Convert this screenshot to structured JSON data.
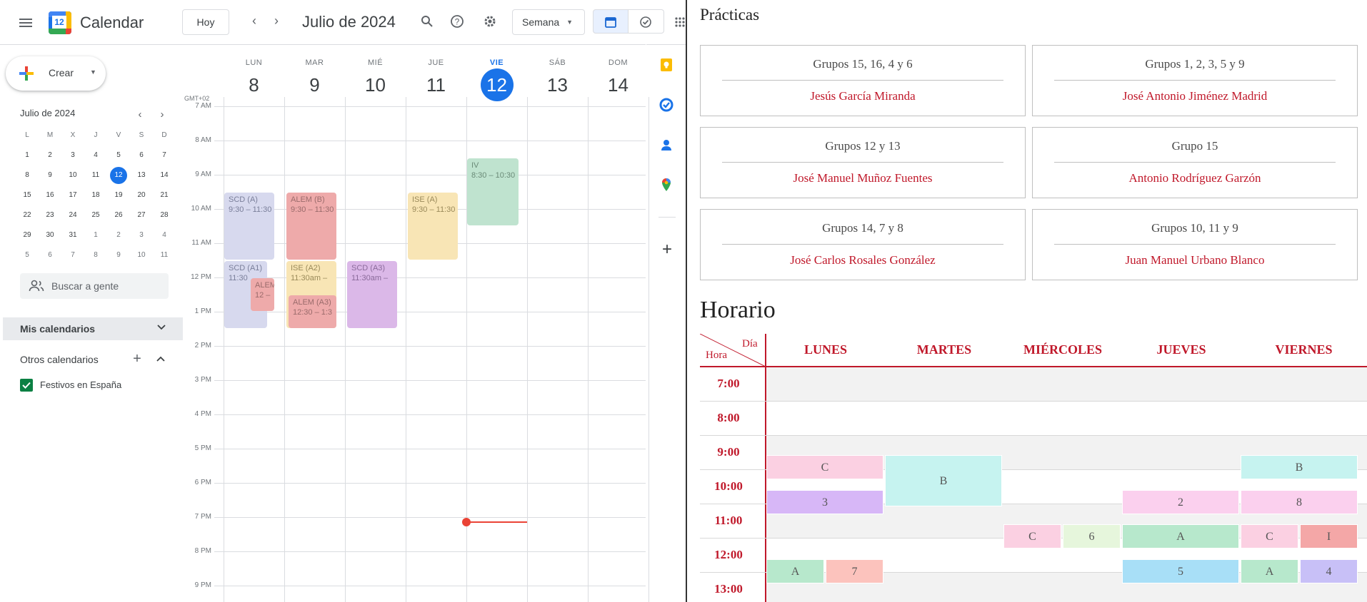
{
  "app": {
    "logo_day": "12",
    "name": "Calendar",
    "today_button": "Hoy",
    "month_title": "Julio de 2024",
    "view_select": "Semana"
  },
  "sidebar": {
    "create_label": "Crear",
    "mini_title": "Julio de 2024",
    "weekday_initials": [
      "L",
      "M",
      "X",
      "J",
      "V",
      "S",
      "D"
    ],
    "weeks": [
      [
        "1",
        "2",
        "3",
        "4",
        "5",
        "6",
        "7"
      ],
      [
        "8",
        "9",
        "10",
        "11",
        "12",
        "13",
        "14"
      ],
      [
        "15",
        "16",
        "17",
        "18",
        "19",
        "20",
        "21"
      ],
      [
        "22",
        "23",
        "24",
        "25",
        "26",
        "27",
        "28"
      ],
      [
        "29",
        "30",
        "31",
        "1",
        "2",
        "3",
        "4"
      ],
      [
        "5",
        "6",
        "7",
        "8",
        "9",
        "10",
        "11"
      ]
    ],
    "search_people": "Buscar a gente",
    "my_calendars": "Mis calendarios",
    "other_calendars": "Otros calendarios",
    "holidays_calendar": "Festivos en España",
    "holidays_color": "#0b8043"
  },
  "week": {
    "timezone": "GMT+02",
    "days": [
      {
        "label": "LUN",
        "num": "8"
      },
      {
        "label": "MAR",
        "num": "9"
      },
      {
        "label": "MIÉ",
        "num": "10"
      },
      {
        "label": "JUE",
        "num": "11"
      },
      {
        "label": "VIE",
        "num": "12"
      },
      {
        "label": "SÁB",
        "num": "13"
      },
      {
        "label": "DOM",
        "num": "14"
      }
    ],
    "today_index": 4,
    "hours": [
      "7 AM",
      "8 AM",
      "9 AM",
      "10 AM",
      "11 AM",
      "12 PM",
      "1 PM",
      "2 PM",
      "3 PM",
      "4 PM",
      "5 PM",
      "6 PM",
      "7 PM",
      "8 PM",
      "9 PM"
    ],
    "events": [
      {
        "title": "SCD (A)",
        "time": "9:30 – 11:30",
        "color": "#d7d9ee",
        "text": "#7a7f9a"
      },
      {
        "title": "SCD (A1)",
        "time": "11:30",
        "color": "#d7d9ee",
        "text": "#7a7f9a"
      },
      {
        "title": "ALEM",
        "time": "12 –",
        "color": "#eeaaaa",
        "text": "#9a6b6b"
      },
      {
        "title": "ALEM (B)",
        "time": "9:30 – 11:30",
        "color": "#eeaaaa",
        "text": "#9a6b6b"
      },
      {
        "title": "ISE (A2)",
        "time": "11:30am –",
        "color": "#f8e5b5",
        "text": "#9a8a5a"
      },
      {
        "title": "ALEM (A3)",
        "time": "12:30 – 1:3",
        "color": "#eeaaaa",
        "text": "#9a6b6b"
      },
      {
        "title": "SCD (A3)",
        "time": "11:30am –",
        "color": "#dbb8e8",
        "text": "#8a6a9a"
      },
      {
        "title": "ISE (A)",
        "time": "9:30 – 11:30",
        "color": "#f8e5b5",
        "text": "#9a8a5a"
      },
      {
        "title": "IV",
        "time": "8:30 – 10:30",
        "color": "#bfe3cf",
        "text": "#6a8a77"
      }
    ]
  },
  "doc": {
    "practicas_title": "Prácticas",
    "cards": [
      {
        "groups": "Grupos  15, 16, 4 y 6",
        "name": "Jesús García Miranda"
      },
      {
        "groups": "Grupos  1, 2, 3, 5 y 9",
        "name": "José Antonio Jiménez Madrid"
      },
      {
        "groups": "Grupos  12 y 13",
        "name": "José Manuel Muñoz Fuentes"
      },
      {
        "groups": "Grupo  15",
        "name": "Antonio Rodríguez Garzón"
      },
      {
        "groups": "Grupos  14, 7 y 8",
        "name": "José Carlos Rosales González"
      },
      {
        "groups": "Grupos  10, 11 y 9",
        "name": "Juan Manuel Urbano Blanco"
      }
    ],
    "horario_title": "Horario",
    "corner_day": "Día",
    "corner_hour": "Hora",
    "days": [
      "LUNES",
      "MARTES",
      "MIÉRCOLES",
      "JUEVES",
      "VIERNES"
    ],
    "times": [
      "7:00",
      "8:00",
      "9:00",
      "10:00",
      "11:00",
      "12:00",
      "13:00"
    ],
    "cells": [
      {
        "label": "C",
        "color": "#fbd0e2"
      },
      {
        "label": "3",
        "color": "#d7b7f7"
      },
      {
        "label": "A",
        "color": "#b7e8cc"
      },
      {
        "label": "7",
        "color": "#fcc3bd"
      },
      {
        "label": "B",
        "color": "#c6f3f0"
      },
      {
        "label": "C",
        "color": "#fbd0e2"
      },
      {
        "label": "6",
        "color": "#e6f6dc"
      },
      {
        "label": "2",
        "color": "#fbd0ee"
      },
      {
        "label": "A",
        "color": "#b7e8cc"
      },
      {
        "label": "5",
        "color": "#a8dff7"
      },
      {
        "label": "B",
        "color": "#c6f3f0"
      },
      {
        "label": "8",
        "color": "#fbd0ee"
      },
      {
        "label": "C",
        "color": "#fbd0e2"
      },
      {
        "label": "I",
        "color": "#f4a7a7"
      },
      {
        "label": "A",
        "color": "#b7e8cc"
      },
      {
        "label": "4",
        "color": "#c8c0f7"
      }
    ]
  }
}
